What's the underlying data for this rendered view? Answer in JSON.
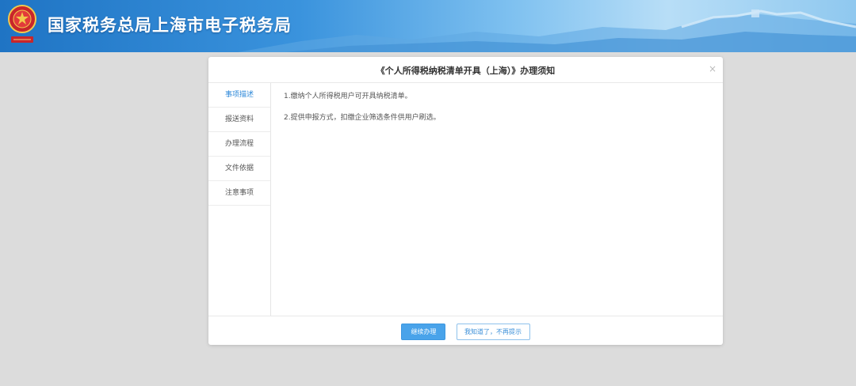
{
  "header": {
    "title": "国家税务总局上海市电子税务局"
  },
  "dialog": {
    "title": "《个人所得税纳税清单开具（上海）》办理须知",
    "close_icon": "close-icon",
    "nav": [
      {
        "label": "事项描述",
        "active": true
      },
      {
        "label": "报送资料",
        "active": false
      },
      {
        "label": "办理流程",
        "active": false
      },
      {
        "label": "文件依据",
        "active": false
      },
      {
        "label": "注意事项",
        "active": false
      }
    ],
    "content": [
      "1.缴纳个人所得税用户可开具纳税清单。",
      "2.提供申报方式，扣缴企业筛选条件供用户刷选。"
    ],
    "buttons": {
      "continue": "继续办理",
      "dismiss": "我知道了，不再提示"
    }
  },
  "colors": {
    "accent": "#49a3ea",
    "active_nav": "#2b87d8",
    "background": "#dcdcdc"
  }
}
